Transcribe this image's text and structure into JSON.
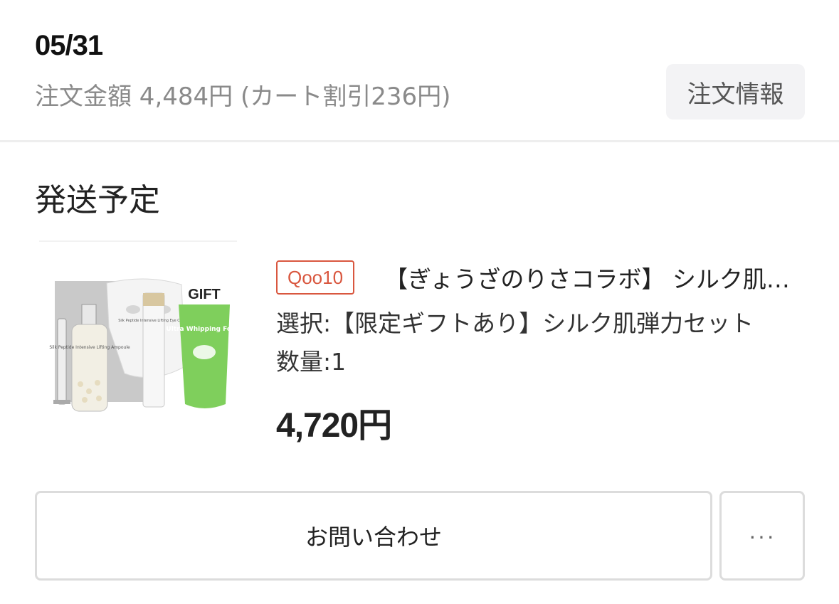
{
  "order": {
    "date": "05/31",
    "summary": "注文金額 4,484円 (カート割引236円)",
    "info_button": "注文情報"
  },
  "shipment": {
    "status_title": "発送予定"
  },
  "item": {
    "image_icon": "product-set-image",
    "image_text": {
      "gift": "GIFT",
      "ampoule": "Silk Peptide Intensive Lifting Ampoule",
      "eye_cream": "Silk Peptide Intensive Lifting Eye Cream",
      "foam": "Ultra Whipping Foam"
    },
    "shop_badge": "Qoo10",
    "title": "【ぎょうざのりさコラボ】 シルク肌弾力セット",
    "option": "選択:【限定ギフトあり】シルク肌弾力セット",
    "quantity": "数量:1",
    "price": "4,720円"
  },
  "actions": {
    "inquiry": "お問い合わせ",
    "more": "···"
  },
  "colors": {
    "badge": "#d9573f",
    "divider": "#eeeeee",
    "button_border": "#dcdcdc"
  }
}
